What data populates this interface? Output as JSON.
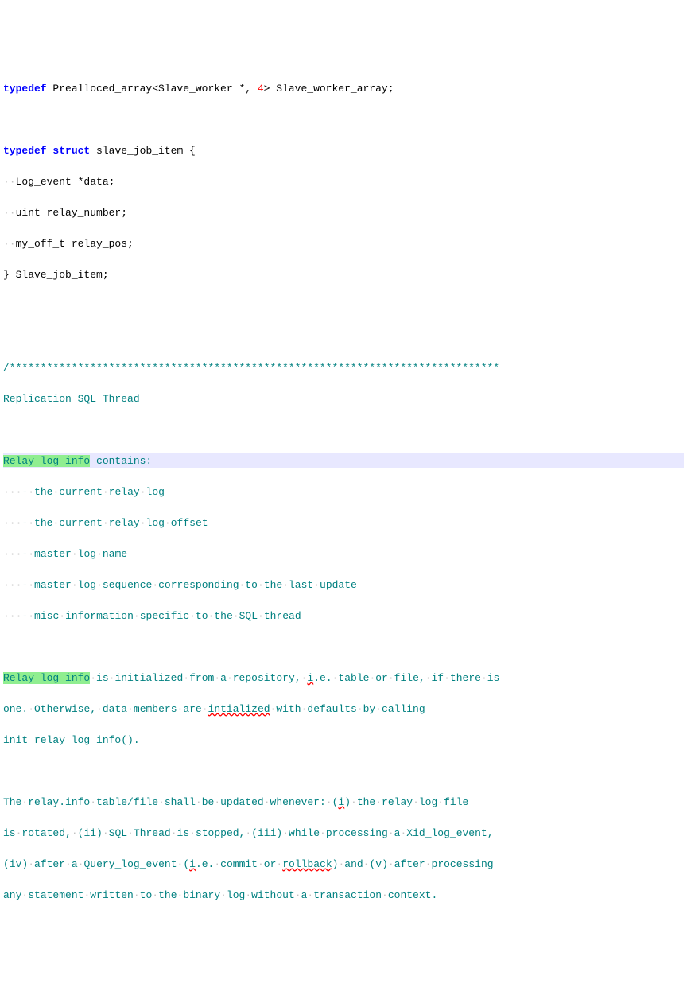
{
  "code": {
    "line1_typedef": "typedef",
    "line1_rest1": " Prealloced_array<Slave_worker *, ",
    "line1_num": "4",
    "line1_rest2": "> Slave_worker_array;",
    "line3_typedef": "typedef",
    "line3_struct": "struct",
    "line3_rest": " slave_job_item {",
    "line4": "Log_event *data;",
    "line5": "uint relay_number;",
    "line6": "my_off_t relay_pos;",
    "line7": "} Slave_job_item;",
    "comment_stars": "/*******************************************************************************",
    "comment_title": "Replication SQL Thread",
    "relay_log_info": "Relay_log_info",
    "contains": " contains:",
    "bullet1": "- the current relay log",
    "bullet2": "- the current relay log offset",
    "bullet3": "- master log name",
    "bullet4": "- master log sequence corresponding to the last update",
    "bullet5": "- misc information specific to the SQL thread",
    "para2_part1": " is initialized from a repository, ",
    "para2_ie": "i",
    "para2_part1b": ".e. table or file, if there is",
    "para2_line2a": "one. Otherwise, data members are ",
    "para2_intialized": "intialized",
    "para2_line2b": " with defaults by calling",
    "para2_line3": "init_relay_log_info().",
    "para3_line1a": "The relay.info table/file shall be updated whenever: (",
    "para3_i1": "i",
    "para3_line1b": ") the relay log file",
    "para3_line2": "is rotated, (ii) SQL Thread is stopped, (iii) while processing a Xid_log_event,",
    "para3_line3a": "(iv) after a Query_log_event (",
    "para3_i2": "i",
    "para3_line3b": ".e. commit or ",
    "para3_rollback": "rollback",
    "para3_line3c": ") and (v) after processing",
    "para3_line4": "any statement written to the binary log without a transaction context."
  },
  "ws": {
    "dot": "·",
    "two_dots": "··",
    "three_dots": "···"
  }
}
